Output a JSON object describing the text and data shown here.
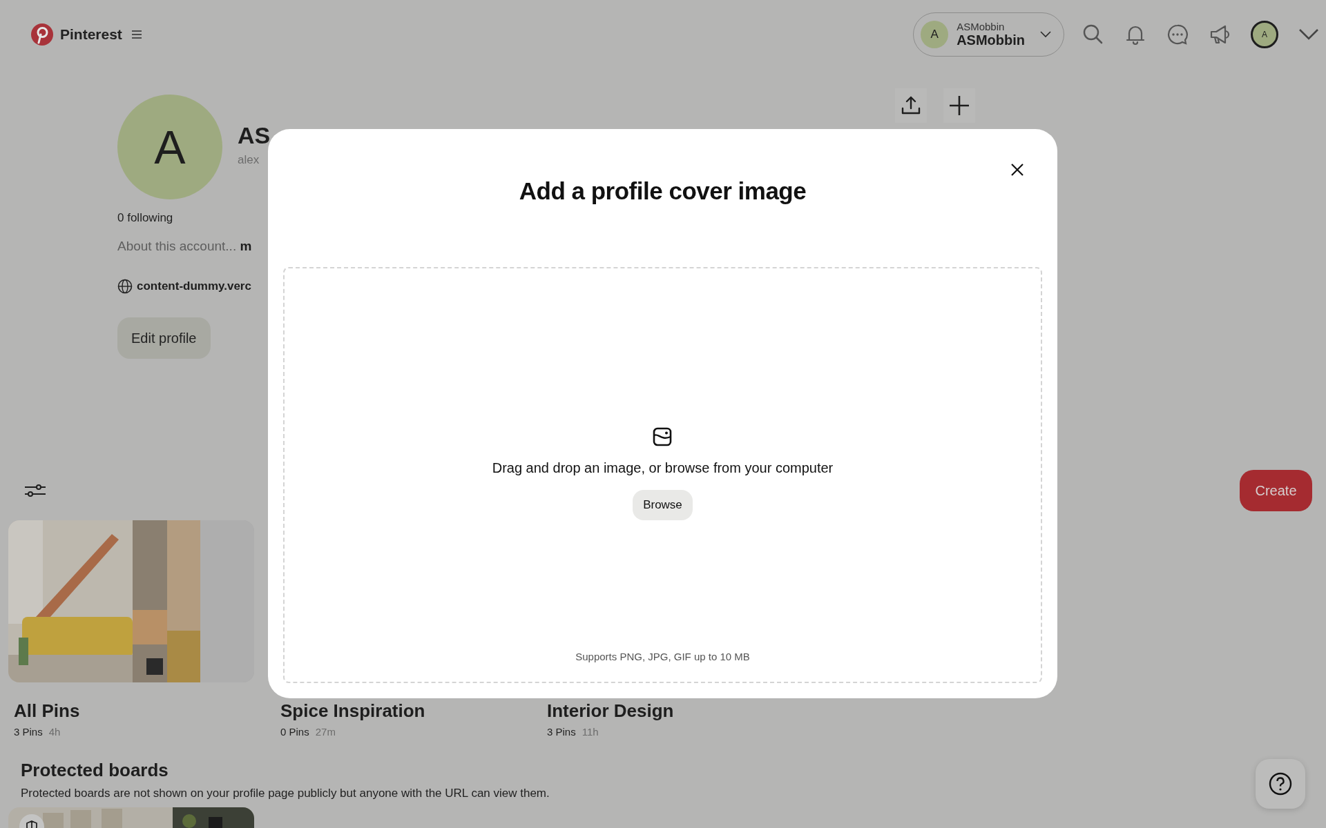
{
  "header": {
    "brand": "Pinterest",
    "account": {
      "avatar_letter": "A",
      "label": "ASMobbin",
      "name": "ASMobbin"
    },
    "avatar_letter": "A"
  },
  "profile": {
    "avatar_letter": "A",
    "name": "AS",
    "username": "alex",
    "following": "0 following",
    "about": "About this account... **m**",
    "website": "content-dummy.verc",
    "edit_button": "Edit profile"
  },
  "boards": [
    {
      "title": "All Pins",
      "count": "3 Pins",
      "age": "4h"
    },
    {
      "title": "Spice Inspiration",
      "count": "0 Pins",
      "age": "27m"
    },
    {
      "title": "Interior Design",
      "count": "3 Pins",
      "age": "11h"
    }
  ],
  "protected": {
    "title": "Protected boards",
    "description": "Protected boards are not shown on your profile page publicly but anyone with the URL can view them."
  },
  "create_button": "Create",
  "modal": {
    "title": "Add a profile cover image",
    "drop_text": "Drag and drop an image, or browse from your computer",
    "browse_button": "Browse",
    "hint": "Supports PNG, JPG, GIF up to 10 MB"
  }
}
